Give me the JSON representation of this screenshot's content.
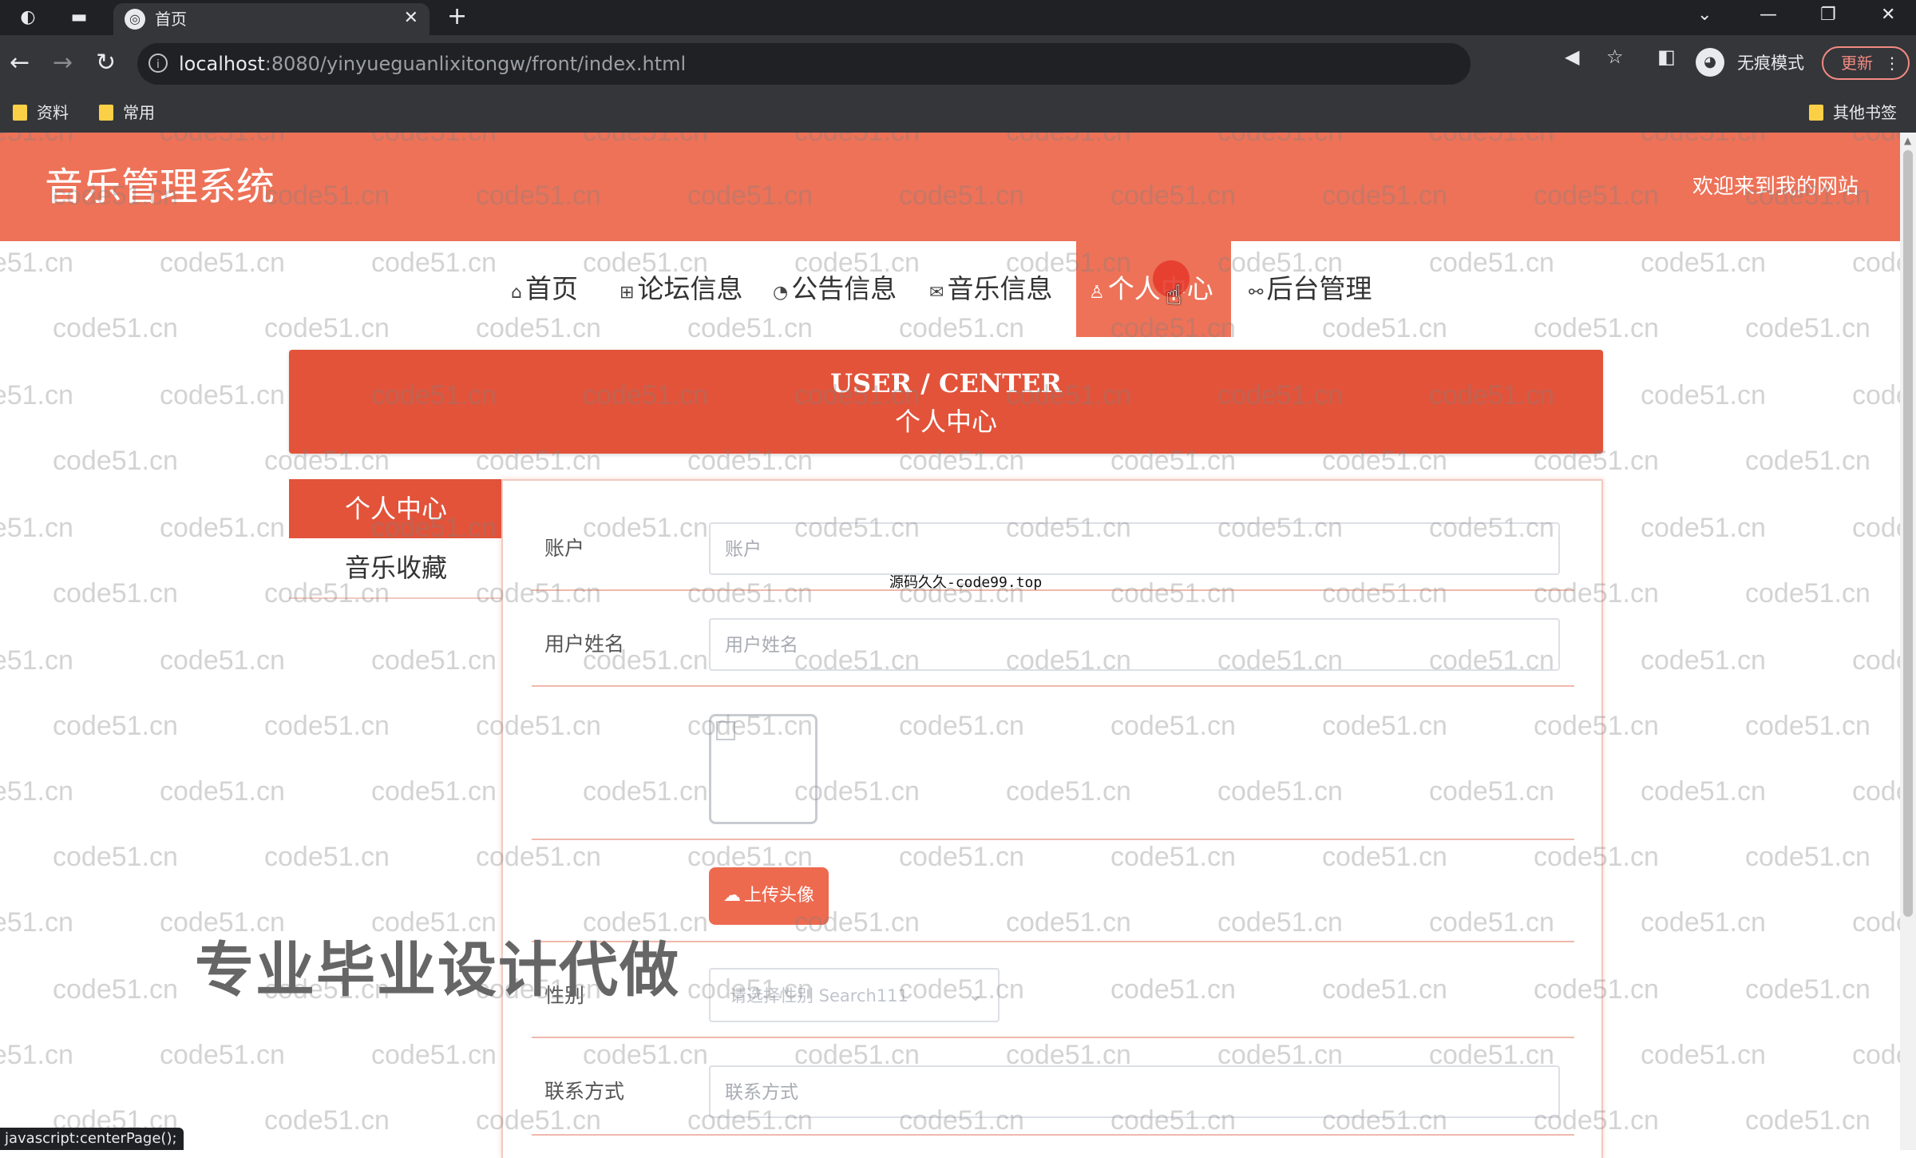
{
  "browser": {
    "tab_title": "首页",
    "url_host": "localhost",
    "url_path": ":8080/yinyueguanlixitongw/front/index.html",
    "incognito_label": "无痕模式",
    "update_label": "更新",
    "bookmarks": [
      "资料",
      "常用"
    ],
    "other_bookmarks": "其他书签"
  },
  "site": {
    "title": "音乐管理系统",
    "welcome": "欢迎来到我的网站"
  },
  "nav": {
    "items": [
      {
        "label": "首页",
        "icon": "home-icon"
      },
      {
        "label": "论坛信息",
        "icon": "forum-icon"
      },
      {
        "label": "公告信息",
        "icon": "notice-icon"
      },
      {
        "label": "音乐信息",
        "icon": "music-icon"
      },
      {
        "label": "个人中心",
        "icon": "user-icon"
      },
      {
        "label": "后台管理",
        "icon": "link-icon"
      }
    ],
    "active_index": 4
  },
  "banner": {
    "en": "USER / CENTER",
    "cn": "个人中心"
  },
  "sidebar": {
    "items": [
      {
        "label": "个人中心"
      },
      {
        "label": "音乐收藏"
      }
    ]
  },
  "form": {
    "account_label": "账户",
    "account_placeholder": "账户",
    "name_label": "用户姓名",
    "name_placeholder": "用户姓名",
    "upload_label": "上传头像",
    "gender_label": "性别",
    "gender_placeholder": "请选择性别 Search111",
    "contact_label": "联系方式",
    "contact_placeholder": "联系方式"
  },
  "overlays": {
    "source_text": "源码久久-code99.top",
    "promo_text": "专业毕业设计代做",
    "watermark": "code51.cn",
    "status_text": "javascript:centerPage();"
  },
  "colors": {
    "header": "#ed7258",
    "banner": "#e2533a",
    "accent": "#ed6a4f"
  }
}
